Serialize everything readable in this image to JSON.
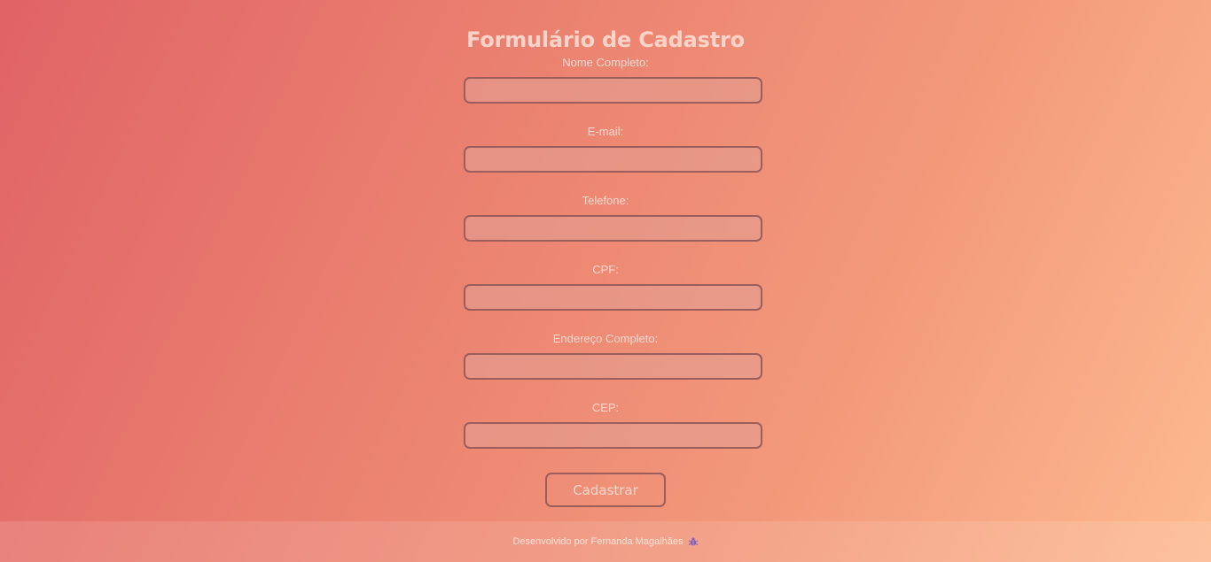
{
  "header": {
    "title": "Formulário de Cadastro"
  },
  "form": {
    "fields": [
      {
        "label": "Nome Completo:",
        "value": "",
        "placeholder": ""
      },
      {
        "label": "E-mail:",
        "value": "",
        "placeholder": ""
      },
      {
        "label": "Telefone:",
        "value": "",
        "placeholder": ""
      },
      {
        "label": "CPF:",
        "value": "",
        "placeholder": ""
      },
      {
        "label": "Endereço Completo:",
        "value": "",
        "placeholder": ""
      },
      {
        "label": "CEP:",
        "value": "",
        "placeholder": ""
      }
    ],
    "submit_label": "Cadastrar"
  },
  "footer": {
    "credit": "Desenvolvido por Fernanda Magalhães",
    "icon": "bug-icon"
  },
  "colors": {
    "gradient_start": "#e06366",
    "gradient_end": "#fdba90",
    "input_border": "#9b5e5c",
    "title": "#fbd3c9"
  }
}
